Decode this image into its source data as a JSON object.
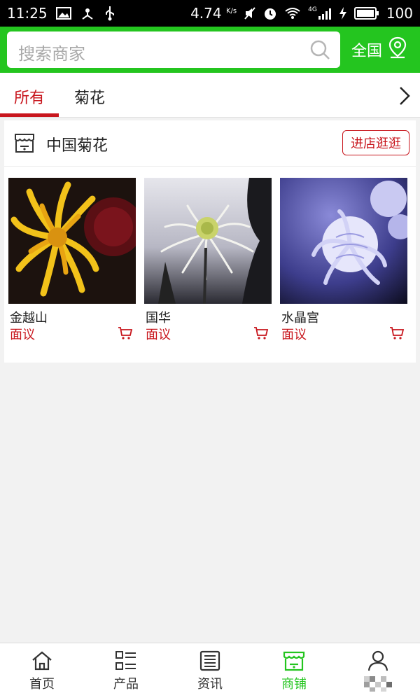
{
  "status_bar": {
    "time": "11:25",
    "speed": "4.74",
    "speed_unit": "K/s",
    "network": "4G",
    "battery": "100"
  },
  "header": {
    "search_placeholder": "搜索商家",
    "region_label": "全国",
    "accent_color": "#24c51f"
  },
  "tabs": [
    {
      "label": "所有",
      "active": true
    },
    {
      "label": "菊花",
      "active": false
    }
  ],
  "store": {
    "name": "中国菊花",
    "visit_label": "进店逛逛",
    "products": [
      {
        "name": "金越山",
        "price": "面议",
        "image": "yellow-chrysanthemum"
      },
      {
        "name": "国华",
        "price": "面议",
        "image": "white-spider-chrysanthemum"
      },
      {
        "name": "水晶宫",
        "price": "面议",
        "image": "lavender-chrysanthemum"
      }
    ]
  },
  "bottom_nav": [
    {
      "label": "首页",
      "icon": "home-icon",
      "active": false
    },
    {
      "label": "产品",
      "icon": "list-icon",
      "active": false
    },
    {
      "label": "资讯",
      "icon": "news-icon",
      "active": false
    },
    {
      "label": "商铺",
      "icon": "store-icon",
      "active": true
    },
    {
      "label": "",
      "icon": "user-icon",
      "active": false
    }
  ]
}
